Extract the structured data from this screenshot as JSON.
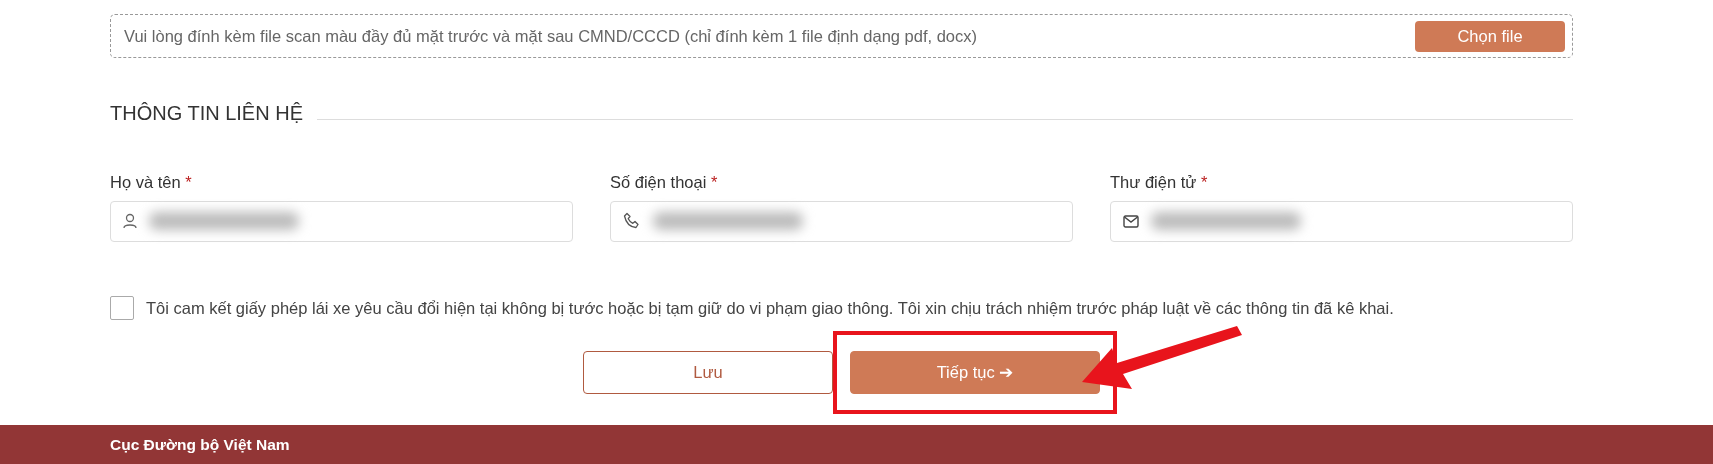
{
  "upload": {
    "hint": "Vui lòng đính kèm file scan màu đầy đủ mặt trước và mặt sau CMND/CCCD (chỉ đính kèm 1 file định dạng pdf, docx)",
    "button": "Chọn file"
  },
  "section_title": "THÔNG TIN LIÊN HỆ",
  "fields": [
    {
      "label": "Họ và tên",
      "required_mark": "*",
      "kind": "person"
    },
    {
      "label": "Số điện thoại",
      "required_mark": "*",
      "kind": "phone"
    },
    {
      "label": "Thư điện tử",
      "required_mark": "*",
      "kind": "mail"
    }
  ],
  "commitment": {
    "checked": false,
    "text": "Tôi cam kết giấy phép lái xe yêu cầu đổi hiện tại không bị tước hoặc bị tạm giữ do vi phạm giao thông. Tôi xin chịu trách nhiệm trước pháp luật về các thông tin đã kê khai."
  },
  "buttons": [
    {
      "label": "Lưu",
      "kind": "outline"
    },
    {
      "label": "Tiếp tục ➔",
      "kind": "primary",
      "highlighted": true
    }
  ],
  "footer": {
    "title": "Cục Đường bộ Việt Nam"
  }
}
